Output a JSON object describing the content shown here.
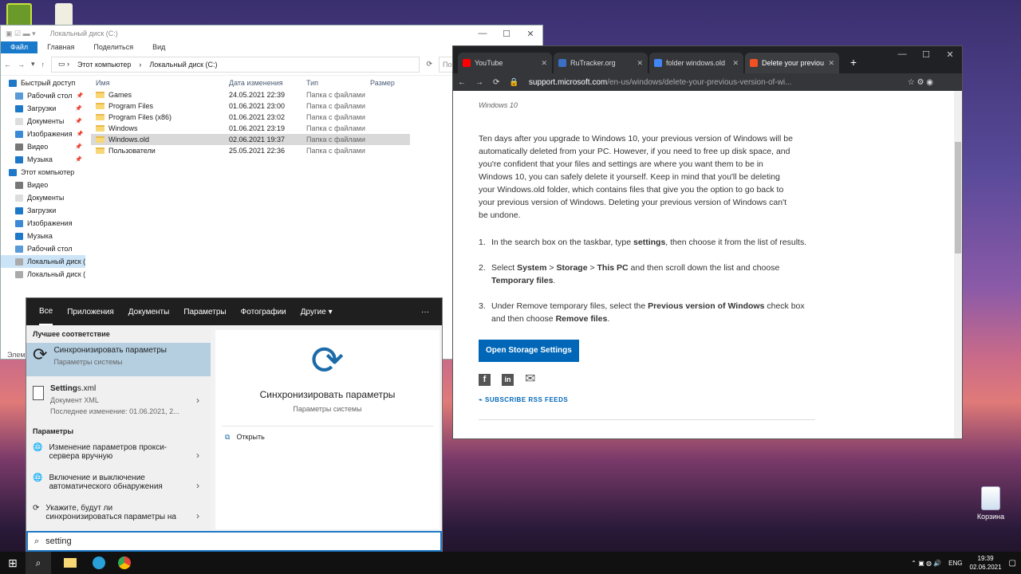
{
  "desktop": {
    "recycle_bin_label": "Корзина"
  },
  "explorer": {
    "title": "Локальный диск (C:)",
    "ribbon_tabs": [
      "Файл",
      "Главная",
      "Поделиться",
      "Вид"
    ],
    "breadcrumb": [
      "Этот компьютер",
      "Локальный диск (C:)"
    ],
    "search_placeholder": "Поис",
    "columns": [
      "Имя",
      "Дата изменения",
      "Тип",
      "Размер"
    ],
    "files": [
      {
        "name": "Games",
        "date": "24.05.2021 22:39",
        "type": "Папка с файлами"
      },
      {
        "name": "Program Files",
        "date": "01.06.2021 23:00",
        "type": "Папка с файлами"
      },
      {
        "name": "Program Files (x86)",
        "date": "01.06.2021 23:02",
        "type": "Папка с файлами"
      },
      {
        "name": "Windows",
        "date": "01.06.2021 23:19",
        "type": "Папка с файлами"
      },
      {
        "name": "Windows.old",
        "date": "02.06.2021 19:37",
        "type": "Папка с файлами"
      },
      {
        "name": "Пользователи",
        "date": "25.05.2021 22:36",
        "type": "Папка с файлами"
      }
    ],
    "nav": [
      {
        "label": "Быстрый доступ",
        "pin": false
      },
      {
        "label": "Рабочий стол",
        "pin": true
      },
      {
        "label": "Загрузки",
        "pin": true
      },
      {
        "label": "Документы",
        "pin": true
      },
      {
        "label": "Изображения",
        "pin": true
      },
      {
        "label": "Видео",
        "pin": true
      },
      {
        "label": "Музыка",
        "pin": true
      },
      {
        "label": "Этот компьютер",
        "pin": false
      },
      {
        "label": "Видео",
        "pin": false
      },
      {
        "label": "Документы",
        "pin": false
      },
      {
        "label": "Загрузки",
        "pin": false
      },
      {
        "label": "Изображения",
        "pin": false
      },
      {
        "label": "Музыка",
        "pin": false
      },
      {
        "label": "Рабочий стол",
        "pin": false
      },
      {
        "label": "Локальный диск (C",
        "pin": false
      },
      {
        "label": "Локальный диск (D",
        "pin": false
      }
    ],
    "status_text": "Элем"
  },
  "search": {
    "tabs": [
      "Все",
      "Приложения",
      "Документы",
      "Параметры",
      "Фотографии",
      "Другие"
    ],
    "more": "···",
    "best_match_header": "Лучшее соответствие",
    "best_match": {
      "title": "Синхронизировать параметры",
      "subtitle": "Параметры системы"
    },
    "file_result": {
      "title_bold": "Setting",
      "title_rest": "s.xml",
      "subtitle": "Документ XML",
      "modified": "Последнее изменение: 01.06.2021, 2..."
    },
    "settings_header": "Параметры",
    "settings_results": [
      {
        "line1": "Изменение параметров прокси-",
        "line2": "сервера вручную"
      },
      {
        "line1": "Включение и выключение",
        "line2": "автоматического обнаружения"
      },
      {
        "line1": "Укажите, будут ли",
        "line2": "синхронизироваться параметры на"
      }
    ],
    "preview": {
      "title": "Синхронизировать параметры",
      "subtitle": "Параметры системы",
      "action": "Открыть"
    },
    "query": "setting"
  },
  "chrome": {
    "tabs": [
      {
        "title": "YouTube",
        "color": "#ff0000"
      },
      {
        "title": "RuTracker.org",
        "color": "#3a6fc4"
      },
      {
        "title": "folder windows.old",
        "color": "#4285f4"
      },
      {
        "title": "Delete your previou",
        "color": "#f25022"
      }
    ],
    "url_host": "support.microsoft.com",
    "url_path": "/en-us/windows/delete-your-previous-version-of-wi...",
    "article": {
      "kicker": "Windows 10",
      "intro": "Ten days after you upgrade to Windows 10, your previous version of Windows will be automatically deleted from your PC. However, if you need to free up disk space, and you're confident that your files and settings are where you want them to be in Windows 10, you can safely delete it yourself. Keep in mind that you'll be deleting your Windows.old folder, which contains files that give you the option to go back to your previous version of Windows. Deleting your previous version of Windows can't be undone.",
      "step1_a": "In the search box on the taskbar, type ",
      "step1_b": "settings",
      "step1_c": ", then choose it from the list of results.",
      "step2_a": "Select ",
      "step2_b": "System",
      "step2_c": " > ",
      "step2_d": "Storage",
      "step2_e": " > ",
      "step2_f": "This PC",
      "step2_g": " and then scroll down the list and choose ",
      "step2_h": "Temporary files",
      "step2_i": ".",
      "step3_a": "Under Remove temporary files, select the ",
      "step3_b": "Previous version of Windows",
      "step3_c": " check box and then choose ",
      "step3_d": "Remove files",
      "step3_e": ".",
      "button": "Open Storage Settings",
      "rss": "SUBSCRIBE RSS FEEDS"
    }
  },
  "taskbar": {
    "lang": "ENG",
    "time": "19:39",
    "date": "02.06.2021"
  }
}
